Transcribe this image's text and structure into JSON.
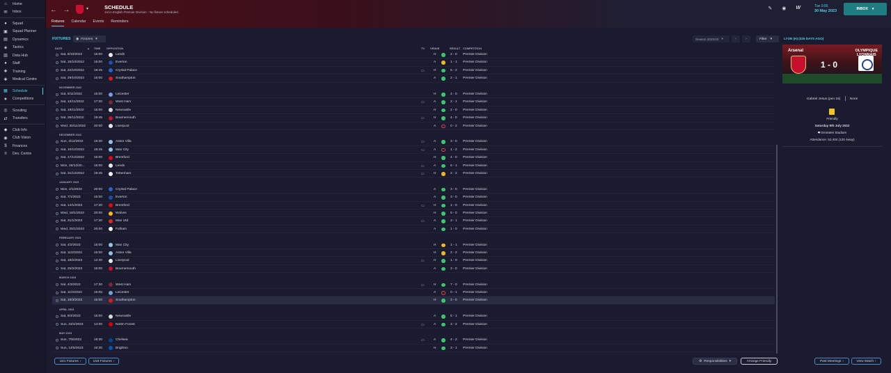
{
  "sidebar": {
    "items": [
      {
        "label": "Home",
        "icon": "home-icon",
        "glyph": "⌂"
      },
      {
        "label": "Inbox",
        "icon": "inbox-icon",
        "glyph": "✉"
      },
      {
        "label": "Squad",
        "icon": "squad-icon",
        "glyph": "●"
      },
      {
        "label": "Squad Planner",
        "icon": "planner-icon",
        "glyph": "▣"
      },
      {
        "label": "Dynamics",
        "icon": "dynamics-icon",
        "glyph": "▤"
      },
      {
        "label": "Tactics",
        "icon": "tactics-icon",
        "glyph": "◈"
      },
      {
        "label": "Data Hub",
        "icon": "data-hub-icon",
        "glyph": "▥"
      },
      {
        "label": "Staff",
        "icon": "staff-icon",
        "glyph": "●"
      },
      {
        "label": "Training",
        "icon": "training-icon",
        "glyph": "✚"
      },
      {
        "label": "Medical Centre",
        "icon": "medical-icon",
        "glyph": "✚"
      },
      {
        "label": "Schedule",
        "icon": "calendar-icon",
        "glyph": "▦"
      },
      {
        "label": "Competitions",
        "icon": "trophy-icon",
        "glyph": "★"
      },
      {
        "label": "Scouting",
        "icon": "scouting-icon",
        "glyph": "◎"
      },
      {
        "label": "Transfers",
        "icon": "transfers-icon",
        "glyph": "⇄"
      },
      {
        "label": "Club Info",
        "icon": "club-info-icon",
        "glyph": "◆"
      },
      {
        "label": "Club Vision",
        "icon": "vision-icon",
        "glyph": "◉"
      },
      {
        "label": "Finances",
        "icon": "finances-icon",
        "glyph": "$"
      },
      {
        "label": "Dev. Centre",
        "icon": "dev-centre-icon",
        "glyph": "≡"
      }
    ]
  },
  "header": {
    "title": "SCHEDULE",
    "subtitle": "1st in English Premier Division - No fixture scheduled.",
    "tabs": [
      "Fixtures",
      "Calendar",
      "Events",
      "Reminders"
    ],
    "time": "Tue 0:00",
    "date": "30 May 2023",
    "inbox_label": "INBOX"
  },
  "fixtures": {
    "title": "FIXTURES",
    "dropdown": "Fixtures",
    "season": "Season 2022/23",
    "filter": "Filter",
    "columns": {
      "date": "DATE",
      "time": "TIME",
      "opposition": "OPPOSITION",
      "tv": "TV",
      "venue": "VENUE",
      "result": "RESULT",
      "competition": "COMPETITION"
    },
    "rows": [
      {
        "type": "match",
        "date": "Sat, 8/10/2022",
        "time": "15:00",
        "opp": "Leeds",
        "crest": "#e8e8e8",
        "tv": false,
        "venue": "H",
        "res": "w",
        "score": "2 - 0",
        "comp": "Premier Division"
      },
      {
        "type": "match",
        "date": "Sat, 15/10/2022",
        "time": "15:00",
        "opp": "Everton",
        "crest": "#1b4fa8",
        "tv": false,
        "venue": "A",
        "res": "d",
        "score": "1 - 1",
        "comp": "Premier Division"
      },
      {
        "type": "match",
        "date": "Sat, 22/10/2022",
        "time": "19:45",
        "opp": "Crystal Palace",
        "crest": "#2b62c6",
        "tv": true,
        "venue": "H",
        "res": "w",
        "score": "5 - 2",
        "comp": "Premier Division"
      },
      {
        "type": "match",
        "date": "Sat, 29/10/2022",
        "time": "15:00",
        "opp": "Southampton",
        "crest": "#d71920",
        "tv": false,
        "venue": "A",
        "res": "w",
        "score": "2 - 1",
        "comp": "Premier Division"
      },
      {
        "type": "month",
        "label": "NOVEMBER 2022"
      },
      {
        "type": "match",
        "date": "Sat, 5/11/2022",
        "time": "15:00",
        "opp": "Leicester",
        "crest": "#7a9fd8",
        "tv": false,
        "venue": "H",
        "res": "w",
        "score": "4 - 0",
        "comp": "Premier Division"
      },
      {
        "type": "match",
        "date": "Sat, 12/11/2022",
        "time": "17:30",
        "opp": "West Ham",
        "crest": "#7a263a",
        "tv": true,
        "venue": "A",
        "res": "w",
        "score": "2 - 1",
        "comp": "Premier Division"
      },
      {
        "type": "match",
        "date": "Sat, 19/11/2022",
        "time": "15:00",
        "opp": "Newcastle",
        "crest": "#d9d9d9",
        "tv": false,
        "venue": "H",
        "res": "w",
        "score": "2 - 0",
        "comp": "Premier Division"
      },
      {
        "type": "match",
        "date": "Sat, 26/11/2022",
        "time": "19:45",
        "opp": "Bournemouth",
        "crest": "#c8102e",
        "tv": true,
        "venue": "H",
        "res": "w",
        "score": "4 - 0",
        "comp": "Premier Division"
      },
      {
        "type": "match",
        "date": "Wed, 30/11/2022",
        "time": "20:00",
        "opp": "Liverpool",
        "crest": "#e8e8e8",
        "tv": false,
        "venue": "A",
        "res": "l",
        "score": "0 - 2",
        "comp": "Premier Division"
      },
      {
        "type": "month",
        "label": "DECEMBER 2022"
      },
      {
        "type": "match",
        "date": "Sun, 4/12/2022",
        "time": "16:30",
        "opp": "Aston Villa",
        "crest": "#95bfe5",
        "tv": true,
        "venue": "A",
        "res": "w",
        "score": "3 - 0",
        "comp": "Premier Division"
      },
      {
        "type": "match",
        "date": "Sat, 10/12/2022",
        "time": "19:45",
        "opp": "Man City",
        "crest": "#98c5e9",
        "tv": true,
        "venue": "A",
        "res": "l",
        "score": "1 - 2",
        "comp": "Premier Division"
      },
      {
        "type": "match",
        "date": "Sat, 17/12/2022",
        "time": "15:00",
        "opp": "Brentford",
        "crest": "#e30613",
        "tv": false,
        "venue": "H",
        "res": "w",
        "score": "4 - 0",
        "comp": "Premier Division"
      },
      {
        "type": "match",
        "date": "Mon, 26/12/20...",
        "time": "15:00",
        "opp": "Leeds",
        "crest": "#e8e8e8",
        "tv": true,
        "venue": "A",
        "res": "w",
        "score": "6 - 1",
        "comp": "Premier Division"
      },
      {
        "type": "match",
        "date": "Sat, 31/12/2022",
        "time": "19:45",
        "opp": "Tottenham",
        "crest": "#f0f0f0",
        "tv": true,
        "venue": "H",
        "res": "d",
        "score": "2 - 2",
        "comp": "Premier Division"
      },
      {
        "type": "month",
        "label": "JANUARY 2023"
      },
      {
        "type": "match",
        "date": "Mon, 2/1/2023",
        "time": "20:00",
        "opp": "Crystal Palace",
        "crest": "#2b62c6",
        "tv": false,
        "venue": "A",
        "res": "w",
        "score": "3 - 0",
        "comp": "Premier Division"
      },
      {
        "type": "match",
        "date": "Sat, 7/1/2023",
        "time": "15:00",
        "opp": "Everton",
        "crest": "#1b4fa8",
        "tv": false,
        "venue": "A",
        "res": "w",
        "score": "3 - 0",
        "comp": "Premier Division"
      },
      {
        "type": "match",
        "date": "Sat, 14/1/2023",
        "time": "17:30",
        "opp": "Brentford",
        "crest": "#e30613",
        "tv": true,
        "venue": "H",
        "res": "w",
        "score": "1 - 0",
        "comp": "Premier Division"
      },
      {
        "type": "match",
        "date": "Wed, 18/1/2023",
        "time": "20:00",
        "opp": "Wolves",
        "crest": "#fdb913",
        "tv": false,
        "venue": "H",
        "res": "w",
        "score": "5 - 0",
        "comp": "Premier Division"
      },
      {
        "type": "match",
        "date": "Sat, 21/1/2023",
        "time": "17:30",
        "opp": "Man Utd",
        "crest": "#da291c",
        "tv": true,
        "venue": "A",
        "res": "w",
        "score": "3 - 1",
        "comp": "Premier Division"
      },
      {
        "type": "match",
        "date": "Wed, 25/1/2023",
        "time": "20:00",
        "opp": "Fulham",
        "crest": "#f0f0f0",
        "tv": false,
        "venue": "A",
        "res": "w",
        "score": "1 - 0",
        "comp": "Premier Division"
      },
      {
        "type": "month",
        "label": "FEBRUARY 2023"
      },
      {
        "type": "match",
        "date": "Sat, 4/2/2023",
        "time": "15:00",
        "opp": "Man City",
        "crest": "#98c5e9",
        "tv": false,
        "venue": "H",
        "res": "d",
        "score": "1 - 1",
        "comp": "Premier Division"
      },
      {
        "type": "match",
        "date": "Sat, 11/2/2023",
        "time": "15:00",
        "opp": "Aston Villa",
        "crest": "#95bfe5",
        "tv": false,
        "venue": "H",
        "res": "d",
        "score": "2 - 2",
        "comp": "Premier Division"
      },
      {
        "type": "match",
        "date": "Sat, 18/2/2023",
        "time": "12:30",
        "opp": "Liverpool",
        "crest": "#e8e8e8",
        "tv": true,
        "venue": "H",
        "res": "w",
        "score": "1 - 0",
        "comp": "Premier Division"
      },
      {
        "type": "match",
        "date": "Sat, 25/2/2023",
        "time": "15:00",
        "opp": "Bournemouth",
        "crest": "#c8102e",
        "tv": false,
        "venue": "A",
        "res": "w",
        "score": "3 - 0",
        "comp": "Premier Division"
      },
      {
        "type": "month",
        "label": "MARCH 2023"
      },
      {
        "type": "match",
        "date": "Sat, 4/3/2023",
        "time": "17:30",
        "opp": "West Ham",
        "crest": "#7a263a",
        "tv": true,
        "venue": "H",
        "res": "w",
        "score": "7 - 0",
        "comp": "Premier Division"
      },
      {
        "type": "match",
        "date": "Sat, 11/3/2023",
        "time": "15:00",
        "opp": "Leicester",
        "crest": "#7a9fd8",
        "tv": false,
        "venue": "A",
        "res": "l",
        "score": "0 - 1",
        "comp": "Premier Division"
      },
      {
        "type": "match",
        "date": "Sat, 18/3/2023",
        "time": "15:00",
        "opp": "Southampton",
        "crest": "#d71920",
        "tv": false,
        "venue": "H",
        "res": "w",
        "score": "3 - 0",
        "comp": "Premier Division",
        "selected": true
      },
      {
        "type": "month",
        "label": "APRIL 2023"
      },
      {
        "type": "match",
        "date": "Sat, 8/4/2023",
        "time": "15:00",
        "opp": "Newcastle",
        "crest": "#d9d9d9",
        "tv": false,
        "venue": "A",
        "res": "w",
        "score": "5 - 1",
        "comp": "Premier Division"
      },
      {
        "type": "match",
        "date": "Sun, 23/4/2023",
        "time": "14:00",
        "opp": "Nottm Forest",
        "crest": "#dd0000",
        "tv": true,
        "venue": "A",
        "res": "w",
        "score": "3 - 2",
        "comp": "Premier Division"
      },
      {
        "type": "month",
        "label": "MAY 2023"
      },
      {
        "type": "match",
        "date": "Sun, 7/5/2023",
        "time": "16:30",
        "opp": "Chelsea",
        "crest": "#034694",
        "tv": true,
        "venue": "A",
        "res": "w",
        "score": "4 - 2",
        "comp": "Premier Division"
      },
      {
        "type": "match",
        "date": "Sun, 14/5/2023",
        "time": "16:30",
        "opp": "Brighton",
        "crest": "#0057b8",
        "tv": false,
        "venue": "H",
        "res": "w",
        "score": "3 - 1",
        "comp": "Premier Division"
      }
    ],
    "u21_btn": "U21 Fixtures",
    "u18_btn": "U18 Fixtures",
    "responsibilities_btn": "Responsibilities",
    "arrange_btn": "Arrange Friendly"
  },
  "match_panel": {
    "title": "LYON (H) (325 DAYS AGO)",
    "home_team": "Arsenal",
    "away_team_line1": "OLYMPIQUE",
    "away_team_line2": "LYONNAIS",
    "score": "1 - 0",
    "scorer": "Gabriel Jesus (pen 16)",
    "away_scorer": "None",
    "competition": "Friendly",
    "date": "Saturday 9th July 2022",
    "stadium": "Emirates Stadium",
    "attendance": "Attendance: 52,404 (120 Away)",
    "past_meetings_btn": "Past Meetings",
    "view_match_btn": "View Match"
  },
  "colors": {
    "accent": "#4fd1e8",
    "win": "#3dc46e",
    "draw": "#f0b429",
    "loss": "#e0424e",
    "arsenal": "#c8102e"
  }
}
